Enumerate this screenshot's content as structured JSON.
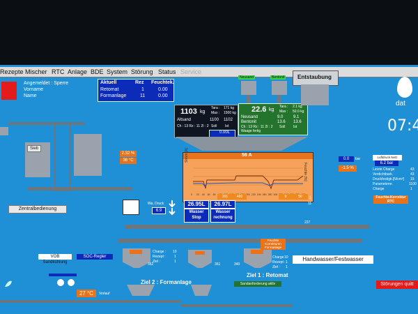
{
  "menu": [
    "Rezepte",
    "Mischer",
    "RTC",
    "Anlage",
    "BDE",
    "System",
    "Störung",
    "Status",
    "Service"
  ],
  "login": {
    "line1": "Angemeldet : Sperre",
    "line2": "Vorname",
    "line3": "Name"
  },
  "aktuell": {
    "headers": [
      "Aktuell",
      "Rez",
      "Feuchtek."
    ],
    "rows": [
      {
        "name": "Retomat",
        "rez": "1",
        "feucht": "0.00"
      },
      {
        "name": "Formanlage",
        "rez": "11",
        "feucht": "0.00"
      }
    ]
  },
  "altsand": {
    "weight": "1103",
    "unit": "kg",
    "tara_label": "Tara :",
    "tara": "171 kg",
    "max_label": "Max :",
    "max": "1500 kg",
    "name": "Altsand",
    "val1": "1100",
    "val2": "1102",
    "ch_line": "Ch : 13 Rz : 11 2I : 2",
    "soll": "Soll",
    "ist": "Ist",
    "water": "0.00L"
  },
  "neusand": {
    "weight": "22.6",
    "unit": "kg",
    "tara_label": "Tara :",
    "tara": "2.1 kg",
    "max_label": "Max :",
    "max": "50.0 kg",
    "rows": [
      {
        "name": "Neusand",
        "a": "9.0",
        "b": "9.1"
      },
      {
        "name": "Bentonit",
        "a": "13.6",
        "b": "13.6"
      }
    ],
    "ch_line": "Ch : 13 Rz : 11 2I : 2",
    "soll": "Soll",
    "ist": "Ist",
    "status": "Waage fertig",
    "silo1": "Neusand",
    "silo2": "Bentonit"
  },
  "entstaubung": "Entstaubung",
  "mixer": {
    "title": "56 A",
    "axis_ticks": [
      "0",
      "10",
      "20",
      "30",
      "40",
      "50",
      "60",
      "70",
      "80",
      "90",
      "100",
      "110",
      "120",
      "130",
      "140",
      "150",
      "160",
      "170",
      "180",
      "190",
      "200",
      "210",
      "220",
      "230",
      "240",
      "250",
      "260",
      "270",
      "280",
      "290",
      "300",
      "310",
      "320",
      "330",
      "340",
      "350",
      "360",
      "370",
      "380",
      "390",
      "400"
    ],
    "left_label": "Strom [A]",
    "right_label": "Feuchte [%]",
    "v1": "101",
    "v2": "400",
    "v3": "0",
    "v4": "50"
  },
  "sieb": "Sieb",
  "zentral": "Zentralbedienung",
  "temp1": "2.32 %",
  "temp2": "36 °C",
  "water": {
    "drucklabel": "Wa. Druck",
    "druck": "6.9",
    "w1": "26.95L",
    "w2": "26.97L",
    "btn1": "Wasser Stop",
    "btn2": "Wasser rechnung"
  },
  "right": {
    "val_bar": "0.0",
    "val_bar_unit": "bar",
    "pct": "-1.5 %",
    "luft_title": "Luftdruck Netz",
    "luft_val": "6.2 bar",
    "params": [
      {
        "k": "Letzte Charge",
        "v": "43"
      },
      {
        "k": "Verdichtbark.",
        "v": "43"
      },
      {
        "k": "Druckfestigk.[N/cm²]",
        "v": "15"
      },
      {
        "k": "Parameternr.",
        "v": "1100"
      },
      {
        "k": "Charge",
        "v": "1"
      }
    ],
    "feuchte_btn": "Feuchte-Korrektur RTC",
    "p1": "1",
    "p2": "11",
    "clock": "07:4",
    "logo": "dat"
  },
  "lower": {
    "vob": "VOB Sandkühlung",
    "soc": "SOC-Regler",
    "temp": "27 °C",
    "temp_lbl": "Vorlauf",
    "bin1": {
      "charge": "10",
      "rezept": "1",
      "ziel": "1"
    },
    "bin2": {
      "charge": "10",
      "rezept": "1",
      "ziel": "1"
    },
    "c_label": "Charge :",
    "r_label": "Rezept :",
    "z_label": "Ziel :",
    "n362": "362",
    "n361": "361",
    "n340": "340",
    "n227": "227",
    "ziel2": "Ziel 2 : Formanlage",
    "ziel1": "Ziel 1 : Retomat",
    "sand_req": "Sandanforderung aktiv",
    "feuchte_k": "Feuchte Korrekturen Formanlage",
    "hand": "Handwasser/Festwasser",
    "stoer": "Störungen quitt"
  }
}
